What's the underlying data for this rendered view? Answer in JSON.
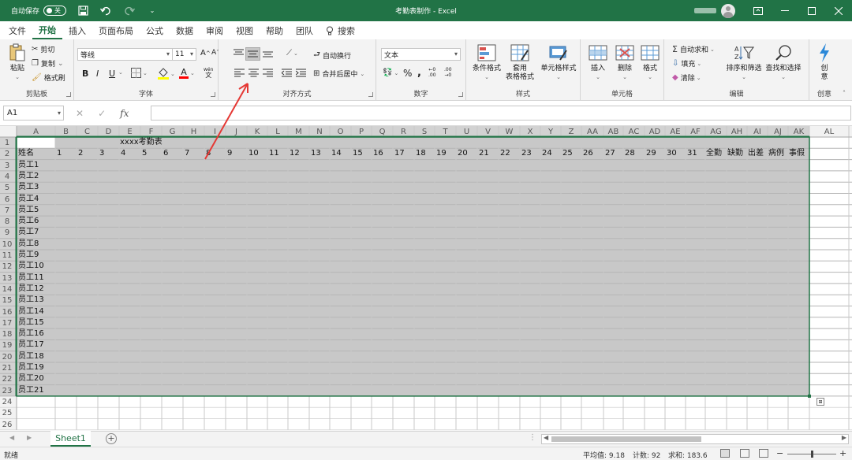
{
  "titlebar": {
    "autosave_label": "自动保存",
    "autosave_state": "关",
    "doc_title": "考勤表制作 - Excel"
  },
  "tabs": [
    "文件",
    "开始",
    "插入",
    "页面布局",
    "公式",
    "数据",
    "审阅",
    "视图",
    "帮助",
    "团队",
    "搜索"
  ],
  "ribbon": {
    "clipboard": {
      "paste": "粘贴",
      "cut": "剪切",
      "copy": "复制",
      "format_painter": "格式刷",
      "label": "剪贴板"
    },
    "font": {
      "name": "等线",
      "size": "11",
      "label": "字体",
      "bold": "B",
      "italic": "I",
      "underline": "U",
      "grow": "A^",
      "shrink": "Aˇ"
    },
    "alignment": {
      "wrap": "自动换行",
      "merge": "合并后居中",
      "label": "对齐方式"
    },
    "number": {
      "format": "文本",
      "label": "数字"
    },
    "styles": {
      "conditional": "条件格式",
      "table_1": "套用",
      "table_2": "表格格式",
      "cell_styles": "单元格样式",
      "label": "样式"
    },
    "cells": {
      "insert": "插入",
      "delete": "删除",
      "format": "格式",
      "label": "单元格"
    },
    "editing": {
      "autosum": "自动求和",
      "fill": "填充",
      "clear": "清除",
      "sort": "排序和筛选",
      "find": "查找和选择",
      "label": "编辑"
    },
    "ideas": {
      "line1": "创",
      "line2": "意",
      "label": "创意"
    }
  },
  "formula_bar": {
    "name_box": "A1",
    "cancel": "✕",
    "confirm": "✓",
    "fx": "fx",
    "value": ""
  },
  "sheet": {
    "columns": [
      "A",
      "B",
      "C",
      "D",
      "E",
      "F",
      "G",
      "H",
      "I",
      "J",
      "K",
      "L",
      "M",
      "N",
      "O",
      "P",
      "Q",
      "R",
      "S",
      "T",
      "U",
      "V",
      "W",
      "X",
      "Y",
      "Z",
      "AA",
      "AB",
      "AC",
      "AD",
      "AE",
      "AF",
      "AG",
      "AH",
      "AI",
      "AJ",
      "AK",
      "AL"
    ],
    "rows": [
      "1",
      "2",
      "3",
      "4",
      "5",
      "6",
      "7",
      "8",
      "9",
      "10",
      "11",
      "12",
      "13",
      "14",
      "15",
      "16",
      "17",
      "18",
      "19",
      "20",
      "21",
      "22",
      "23",
      "24",
      "25",
      "26"
    ],
    "title": "xxxx考勤表",
    "name_header": "姓名",
    "days": [
      "1",
      "2",
      "3",
      "4",
      "5",
      "6",
      "7",
      "8",
      "9",
      "10",
      "11",
      "12",
      "13",
      "14",
      "15",
      "16",
      "17",
      "18",
      "19",
      "20",
      "21",
      "22",
      "23",
      "24",
      "25",
      "26",
      "27",
      "28",
      "29",
      "30",
      "31"
    ],
    "summary_headers": [
      "全勤",
      "缺勤",
      "出差",
      "病例",
      "事假"
    ],
    "employees": [
      "员工1",
      "员工2",
      "员工3",
      "员工4",
      "员工5",
      "员工6",
      "员工7",
      "员工8",
      "员工9",
      "员工10",
      "员工11",
      "员工12",
      "员工13",
      "员工14",
      "员工15",
      "员工16",
      "员工17",
      "员工18",
      "员工19",
      "员工20",
      "员工21"
    ],
    "selected_range": "A1:AK23",
    "selection_color": "#c8c8c8",
    "accent": "#217346"
  },
  "sheet_tabs": {
    "active": "Sheet1",
    "add": "+"
  },
  "statusbar": {
    "mode": "就绪",
    "average": "平均值: 9.18",
    "count": "计数: 92",
    "sum": "求和: 183.6"
  }
}
